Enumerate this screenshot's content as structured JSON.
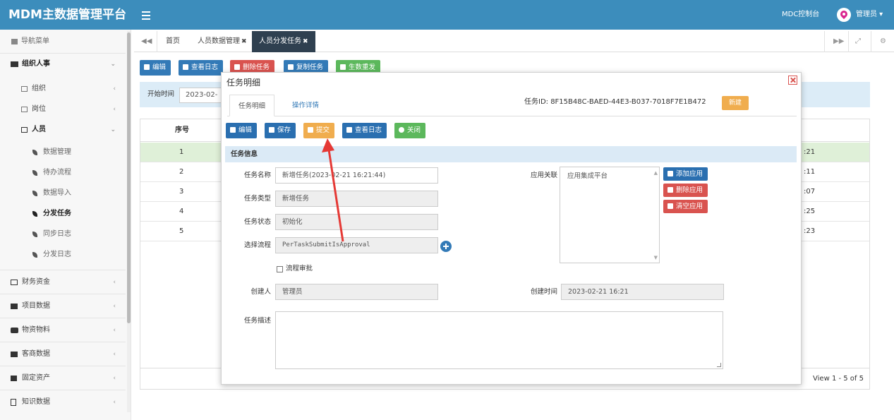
{
  "header": {
    "brand": "MDM主数据管理平台",
    "console_link": "MDC控制台",
    "user_name": "管理员 ▾",
    "brand_color": "#3c8dbc"
  },
  "sidebar": {
    "nav_title": "导航菜单",
    "groups": [
      {
        "label": "组织人事",
        "icon": "users-icon",
        "expanded": true
      },
      {
        "label": "组织",
        "icon": "folder-icon"
      },
      {
        "label": "岗位",
        "icon": "folder-icon"
      },
      {
        "label": "人员",
        "icon": "folder-icon",
        "expanded": true
      },
      {
        "label": "数据管理",
        "icon": "leaf-icon"
      },
      {
        "label": "待办流程",
        "icon": "leaf-icon"
      },
      {
        "label": "数据导入",
        "icon": "leaf-icon"
      },
      {
        "label": "分发任务",
        "icon": "leaf-icon",
        "active": true
      },
      {
        "label": "同步日志",
        "icon": "leaf-icon"
      },
      {
        "label": "分发日志",
        "icon": "leaf-icon"
      },
      {
        "label": "财务资金",
        "icon": "card-icon"
      },
      {
        "label": "项目数据",
        "icon": "sitemap-icon"
      },
      {
        "label": "物资物料",
        "icon": "cubes-icon"
      },
      {
        "label": "客商数据",
        "icon": "briefcase-icon"
      },
      {
        "label": "固定资产",
        "icon": "list-icon"
      },
      {
        "label": "知识数据",
        "icon": "file-icon"
      }
    ]
  },
  "tabs": {
    "home": "首页",
    "person_data": "人员数据管理",
    "dispatch_task": "人员分发任务",
    "close_mark": "✖"
  },
  "toolbar": {
    "edit": "编辑",
    "view_log": "查看日志",
    "delete_task": "删除任务",
    "copy_task": "复制任务",
    "regenerate": "生数重发"
  },
  "filter": {
    "start_label": "开始时间",
    "start_value": "2023-02-"
  },
  "grid": {
    "header_no": "序号",
    "rows": [
      {
        "no": "1",
        "time": ":21"
      },
      {
        "no": "2",
        "time": ":11"
      },
      {
        "no": "3",
        "time": ":07"
      },
      {
        "no": "4",
        "time": ":25"
      },
      {
        "no": "5",
        "time": ":23"
      }
    ],
    "pagination": "View 1 - 5 of 5"
  },
  "modal": {
    "title": "任务明细",
    "tab_detail": "任务明细",
    "tab_ops": "操作详情",
    "task_id": "任务ID: 8F15B48C-BAED-44E3-B037-7018F7E1B472",
    "status_badge": "新建",
    "buttons": {
      "edit": "编辑",
      "save": "保存",
      "submit": "提交",
      "view_log": "查看日志",
      "close": "关闭"
    },
    "section_title": "任务信息",
    "fields": {
      "task_name_label": "任务名称",
      "task_name_value": "新增任务(2023-02-21 16:21:44)",
      "task_type_label": "任务类型",
      "task_type_value": "新增任务",
      "task_status_label": "任务状态",
      "task_status_value": "初始化",
      "flow_label": "选择流程",
      "flow_value": "PerTaskSubmitIsApproval",
      "approval_label": "流程审批",
      "creator_label": "创建人",
      "creator_value": "管理员",
      "create_time_label": "创建时间",
      "create_time_value": "2023-02-21 16:21",
      "desc_label": "任务描述",
      "app_label": "应用关联",
      "app_value": "应用集成平台"
    },
    "app_buttons": {
      "add": "添加应用",
      "delete": "删除应用",
      "clear": "清空应用"
    }
  },
  "colors": {
    "primary": "#337ab7",
    "danger": "#d9534f",
    "success": "#5cb85c",
    "warning": "#f0ad4e",
    "annotation_arrow": "#e53935"
  }
}
